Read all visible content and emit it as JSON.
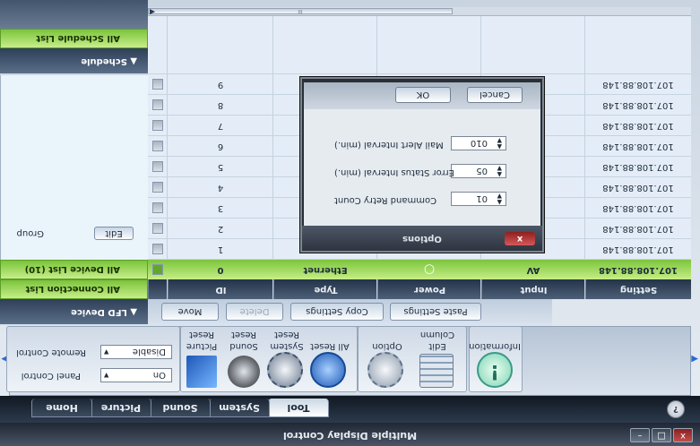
{
  "app": {
    "title": "Multiple Display Control"
  },
  "window_controls": {
    "minimize": "–",
    "maximize": "□",
    "close": "x"
  },
  "tabs": [
    {
      "label": "Home"
    },
    {
      "label": "Picture"
    },
    {
      "label": "Sound"
    },
    {
      "label": "System"
    },
    {
      "label": "Tool"
    }
  ],
  "help": {
    "glyph": "?"
  },
  "controls": {
    "panel_control": {
      "label": "Panel Control",
      "value": "On"
    },
    "remote_control": {
      "label": "Remote Control",
      "value": "Disable"
    }
  },
  "functions": {
    "reset_picture": "Picture Reset",
    "reset_sound": "Sound Reset",
    "reset_system": "System Reset",
    "reset_all": "All Reset",
    "option": "Option",
    "edit_column": "Edit Column",
    "information": "Information"
  },
  "left_panel": {
    "led_device": "LFD Device",
    "all_connection_list": "All Connection List",
    "all_device_list": "All Device List (10)",
    "group_label": "Group",
    "edit_button": "Edit",
    "schedule": "Schedule",
    "all_schedule_list": "All Schedule List"
  },
  "actions": {
    "move": "Move",
    "delete": "Delete",
    "copy": "Copy Settings",
    "paste": "Paste Settings"
  },
  "table": {
    "columns": [
      "ID",
      "Type",
      "Power",
      "Input",
      "Setting"
    ],
    "rows": [
      {
        "id": "0",
        "type": "Ethernet",
        "power": "○",
        "input": "AV",
        "setting": "107.108.88.148",
        "selected": true
      },
      {
        "id": "1",
        "setting": "107.108.88.148"
      },
      {
        "id": "2",
        "setting": "107.108.88.148"
      },
      {
        "id": "3",
        "setting": "107.108.88.148"
      },
      {
        "id": "4",
        "setting": "107.108.88.148"
      },
      {
        "id": "5",
        "setting": "107.108.88.148"
      },
      {
        "id": "6",
        "setting": "107.108.88.148"
      },
      {
        "id": "7",
        "setting": "107.108.88.148"
      },
      {
        "id": "8",
        "setting": "107.108.88.148"
      },
      {
        "id": "9",
        "setting": "107.108.88.148"
      }
    ]
  },
  "options_dialog": {
    "title": "Options",
    "close": "x",
    "fields": [
      {
        "label": "Command Retry Count",
        "value": "01"
      },
      {
        "label": "Error Status Interval (min.)",
        "value": "05"
      },
      {
        "label": "Mail Alert Interval (min.)",
        "value": "010"
      }
    ],
    "ok": "OK",
    "cancel": "Cancel"
  },
  "scroll": {
    "grip": "III"
  },
  "colors": {
    "accent_green": "#7cc43d",
    "header_dark": "#243348",
    "selected_row": "#a7de66"
  }
}
